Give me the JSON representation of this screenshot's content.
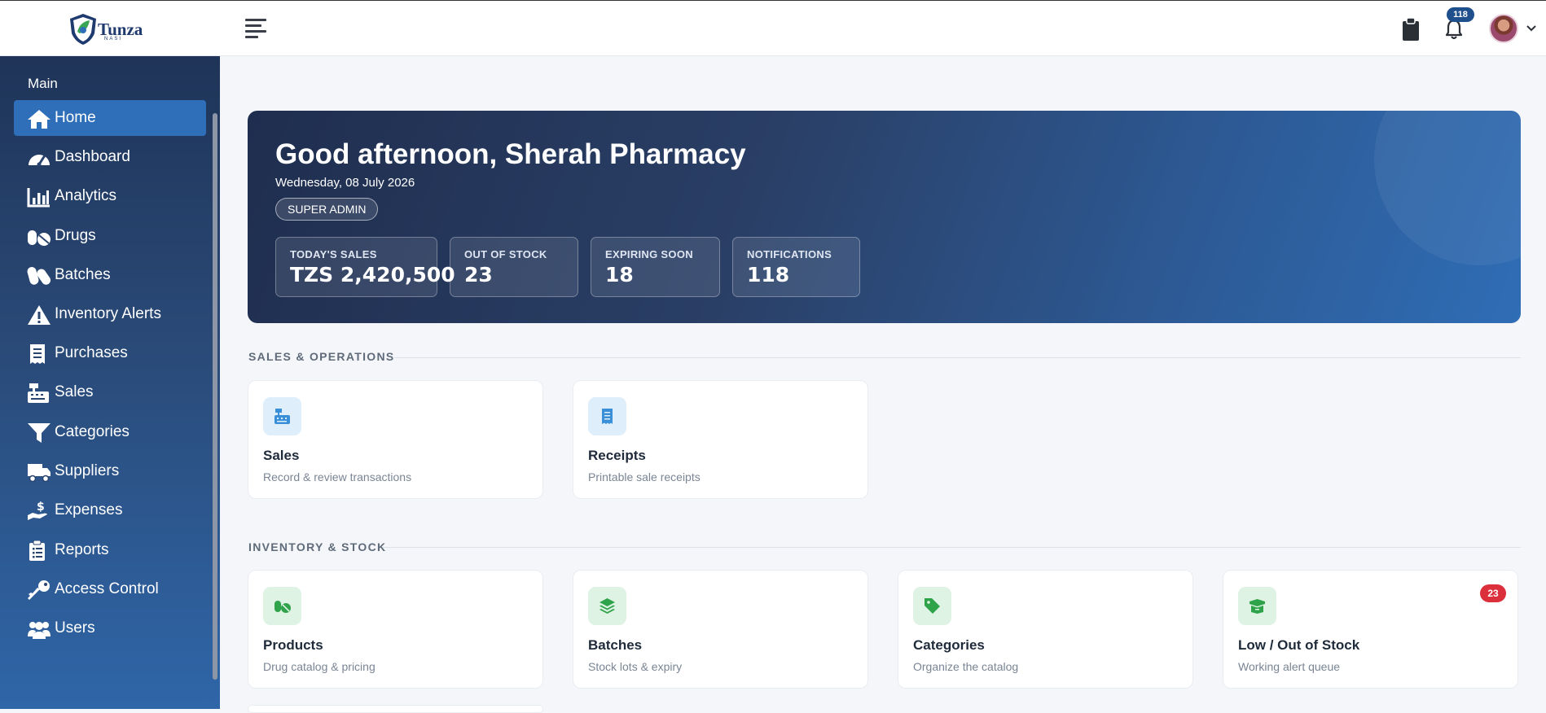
{
  "brand": {
    "name": "Tunza",
    "sub": "NASI"
  },
  "header": {
    "notification_count": "118"
  },
  "sidebar": {
    "heading": "Main",
    "items": [
      {
        "label": "Home",
        "icon": "home-icon",
        "active": true
      },
      {
        "label": "Dashboard",
        "icon": "speedometer-icon"
      },
      {
        "label": "Analytics",
        "icon": "bar-chart-icon"
      },
      {
        "label": "Drugs",
        "icon": "pills-icon"
      },
      {
        "label": "Batches",
        "icon": "capsules-icon"
      },
      {
        "label": "Inventory Alerts",
        "icon": "warning-icon"
      },
      {
        "label": "Purchases",
        "icon": "receipt-icon"
      },
      {
        "label": "Sales",
        "icon": "cash-register-icon"
      },
      {
        "label": "Categories",
        "icon": "filter-icon"
      },
      {
        "label": "Suppliers",
        "icon": "truck-icon"
      },
      {
        "label": "Expenses",
        "icon": "hand-coin-icon"
      },
      {
        "label": "Reports",
        "icon": "clipboard-list-icon"
      },
      {
        "label": "Access Control",
        "icon": "key-icon"
      },
      {
        "label": "Users",
        "icon": "users-icon"
      }
    ]
  },
  "hero": {
    "greeting": "Good afternoon, Sherah Pharmacy",
    "date": "Wednesday, 08 July 2026",
    "role": "SUPER ADMIN",
    "stats": [
      {
        "label": "TODAY'S SALES",
        "value": "TZS 2,420,500"
      },
      {
        "label": "OUT OF STOCK",
        "value": "23"
      },
      {
        "label": "EXPIRING SOON",
        "value": "18"
      },
      {
        "label": "NOTIFICATIONS",
        "value": "118"
      }
    ]
  },
  "sections": [
    {
      "title": "SALES & OPERATIONS",
      "cards": [
        {
          "title": "Sales",
          "subtitle": "Record & review transactions",
          "icon": "cash-register-icon",
          "tone": "blue"
        },
        {
          "title": "Receipts",
          "subtitle": "Printable sale receipts",
          "icon": "receipt-icon",
          "tone": "blue"
        }
      ]
    },
    {
      "title": "INVENTORY & STOCK",
      "cards": [
        {
          "title": "Products",
          "subtitle": "Drug catalog & pricing",
          "icon": "pills-icon",
          "tone": "green"
        },
        {
          "title": "Batches",
          "subtitle": "Stock lots & expiry",
          "icon": "layers-icon",
          "tone": "green"
        },
        {
          "title": "Categories",
          "subtitle": "Organize the catalog",
          "icon": "tags-icon",
          "tone": "green"
        },
        {
          "title": "Low / Out of Stock",
          "subtitle": "Working alert queue",
          "icon": "box-open-icon",
          "tone": "green",
          "badge": "23"
        }
      ]
    }
  ],
  "colors": {
    "sidebar_top": "#1f3458",
    "sidebar_bottom": "#2f66a8",
    "active_item": "#2f6fba",
    "blue_icon": "#3a8fd9",
    "green_icon": "#2ea34a",
    "alert_badge": "#dc2f3c"
  }
}
